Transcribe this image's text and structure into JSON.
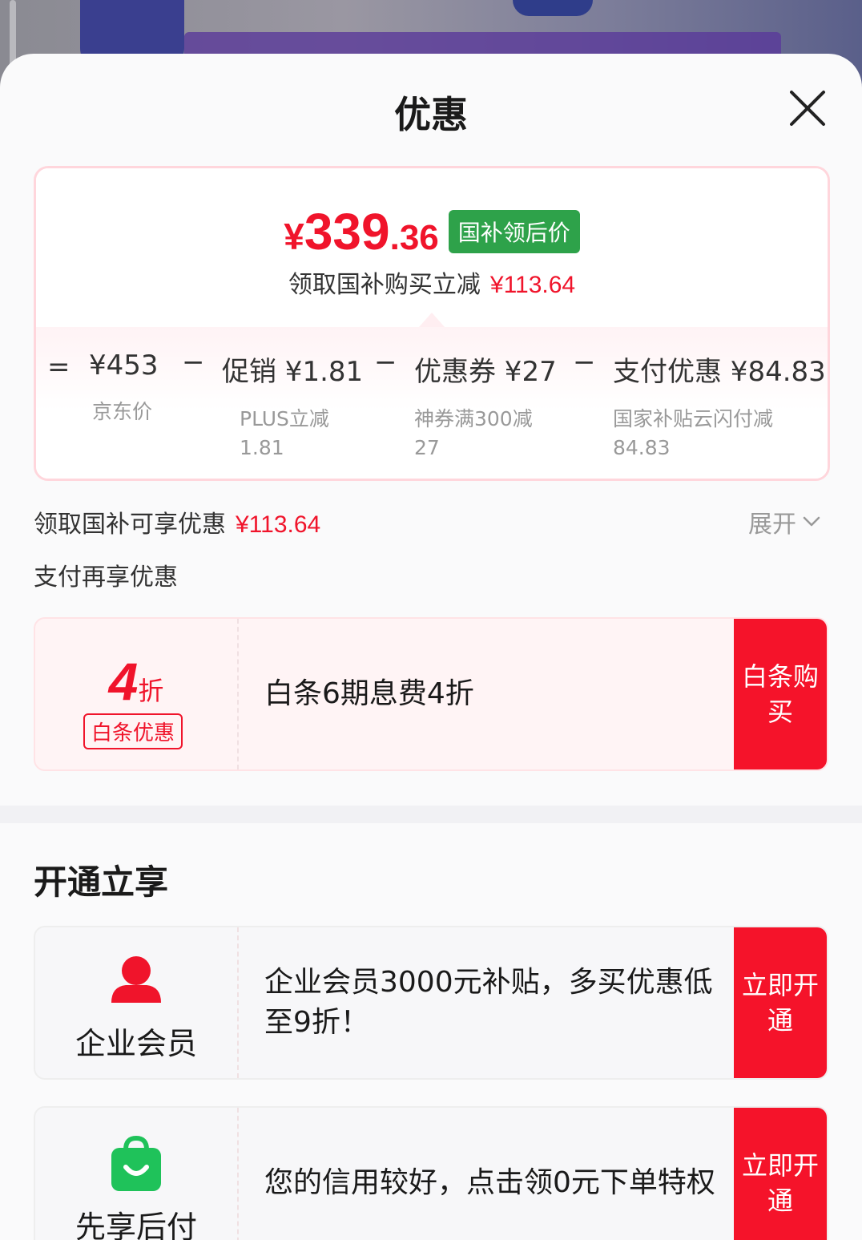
{
  "sheet": {
    "title": "优惠"
  },
  "price": {
    "currency": "¥",
    "integer": "339",
    "decimal": ".36",
    "badge": "国补领后价",
    "sub_text": "领取国补购买立减",
    "sub_amount": "¥113.64"
  },
  "breakdown": {
    "equals": "=",
    "minus": "−",
    "items": [
      {
        "value": "¥453",
        "label": "京东价"
      },
      {
        "value": "促销 ¥1.81",
        "label": "PLUS立减 1.81"
      },
      {
        "value": "优惠券 ¥27",
        "label": "神券满300减 27"
      },
      {
        "value": "支付优惠 ¥84.83",
        "label": "国家补贴云闪付减 84.83"
      }
    ]
  },
  "gov_subsidy": {
    "text": "领取国补可享优惠",
    "amount": "¥113.64",
    "expand_label": "展开"
  },
  "pay_section": {
    "title": "支付再享优惠"
  },
  "baitiao": {
    "discount_num": "4",
    "discount_unit": "折",
    "tag": "白条优惠",
    "desc": "白条6期息费4折",
    "cta": "白条购买"
  },
  "open_section": {
    "title": "开通立享"
  },
  "enterprise": {
    "label": "企业会员",
    "desc": "企业会员3000元补贴，多买优惠低至9折！",
    "cta": "立即开通",
    "icon_color": "#f0142b"
  },
  "paylater": {
    "label": "先享后付",
    "desc": "您的信用较好，点击领0元下单特权",
    "cta": "立即开通",
    "icon_color": "#1fc25a"
  }
}
